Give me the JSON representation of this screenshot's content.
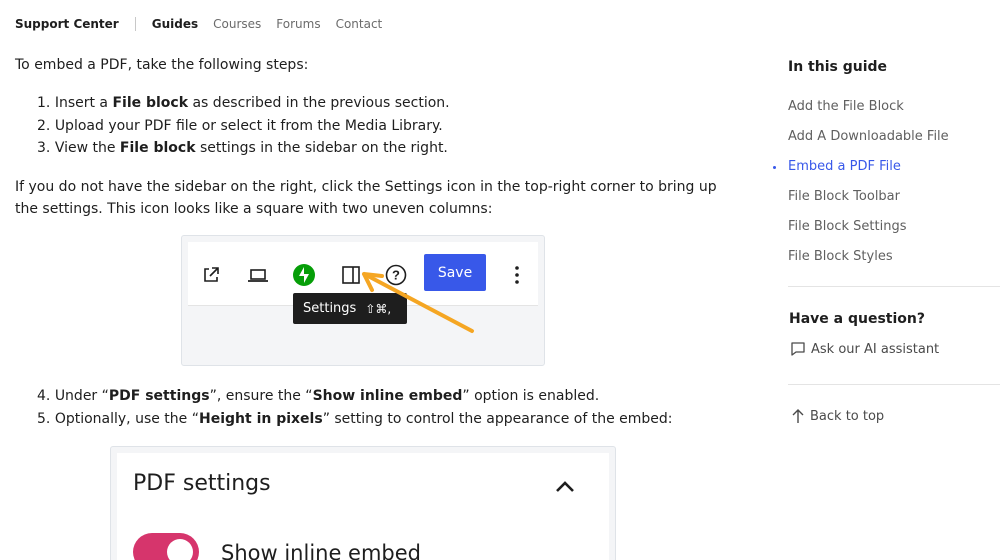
{
  "nav": {
    "brand": "Support Center",
    "links": [
      "Guides",
      "Courses",
      "Forums",
      "Contact"
    ]
  },
  "article": {
    "intro": "To embed a PDF, take the following steps:",
    "steps": [
      {
        "num": "1.",
        "pre": "Insert a ",
        "bold": "File block",
        "post": " as described in the previous section."
      },
      {
        "num": "2.",
        "pre": "Upload your PDF file or select it from the Media Library.",
        "bold": "",
        "post": ""
      },
      {
        "num": "3.",
        "pre": "View the ",
        "bold": "File block",
        "post": " settings in the sidebar on the right."
      }
    ],
    "sidebar_note": "If you do not have the sidebar on the right, click the Settings icon in the top-right corner to bring up the settings. This icon looks like a square with two uneven columns:",
    "steps2": [
      {
        "num": "4.",
        "pre": "Under “",
        "bold": "PDF settings",
        "post": "”, ensure the “",
        "bold2": "Show inline embed",
        "post2": "” option is enabled."
      },
      {
        "num": "5.",
        "pre": "Optionally, use the “",
        "bold": "Height in pixels",
        "post": "” setting to control the appearance of the embed:",
        "bold2": "",
        "post2": ""
      }
    ]
  },
  "toolbar_figure": {
    "save_label": "Save",
    "tooltip_label": "Settings",
    "tooltip_shortcut": "⇧⌘,",
    "icons": [
      "external-link-icon",
      "laptop-preview-icon",
      "jetpack-bolt-icon",
      "sidebar-settings-icon",
      "help-icon",
      "more-options-icon"
    ],
    "accent": "#3858e9",
    "arrow_color": "#f5a623"
  },
  "pdf_figure": {
    "title": "PDF settings",
    "toggle_label": "Show inline embed",
    "toggle_on": true,
    "toggle_color": "#d6356c"
  },
  "sidebar": {
    "toc_title": "In this guide",
    "toc_items": [
      "Add the File Block",
      "Add A Downloadable File",
      "Embed a PDF File",
      "File Block Toolbar",
      "File Block Settings",
      "File Block Styles"
    ],
    "active_index": 2,
    "question_title": "Have a question?",
    "ask_ai": "Ask our AI assistant",
    "back_to_top": "Back to top"
  }
}
